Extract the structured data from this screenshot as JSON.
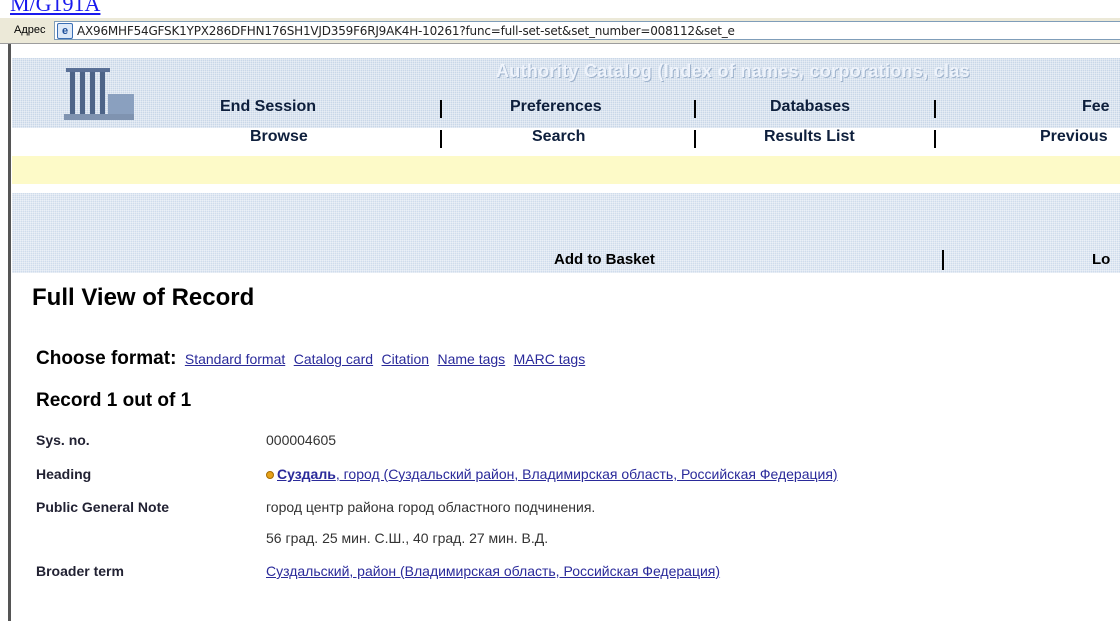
{
  "top_link": "M/G191A",
  "browser": {
    "address_label": "Адрес",
    "address_url": "AX96MHF54GFSK1YPX286DFHN176SH1VJD359F6RJ9AK4H-10261?func=full-set-set&set_number=008112&set_e"
  },
  "catalog": {
    "title": "Authority Catalog (Index of names, corporations, clas",
    "nav_row1": [
      "End Session",
      "Preferences",
      "Databases",
      "Fee"
    ],
    "nav_row2": [
      "Browse",
      "Search",
      "Results List",
      "Previous"
    ]
  },
  "basket": {
    "add_label": "Add to Basket",
    "right_label": "Lo"
  },
  "page": {
    "title": "Full View of Record",
    "choose_label": "Choose format:",
    "formats": [
      "Standard format",
      "Catalog card",
      "Citation",
      "Name tags",
      "MARC tags"
    ],
    "record_count": "Record 1 out of 1"
  },
  "record": {
    "fields": [
      {
        "label": "Sys. no.",
        "value": "000004605"
      },
      {
        "label": "Heading",
        "link_bold": "Суздаль",
        "link_rest": ", город (Суздальский район, Владимирская область, Российская Федерация)"
      },
      {
        "label": "Public General Note",
        "value": "город центр района город областного подчинения."
      },
      {
        "label": "",
        "value": "56 град. 25 мин. С.Ш., 40 град. 27 мин. В.Д."
      },
      {
        "label": "Broader term",
        "link": "Суздальский, район (Владимирская область, Российская Федерация)"
      }
    ]
  },
  "colors": {
    "link": "#2a2a9a",
    "header_bg": "#c9d7e8",
    "yellow_bar": "#fdfac8"
  }
}
